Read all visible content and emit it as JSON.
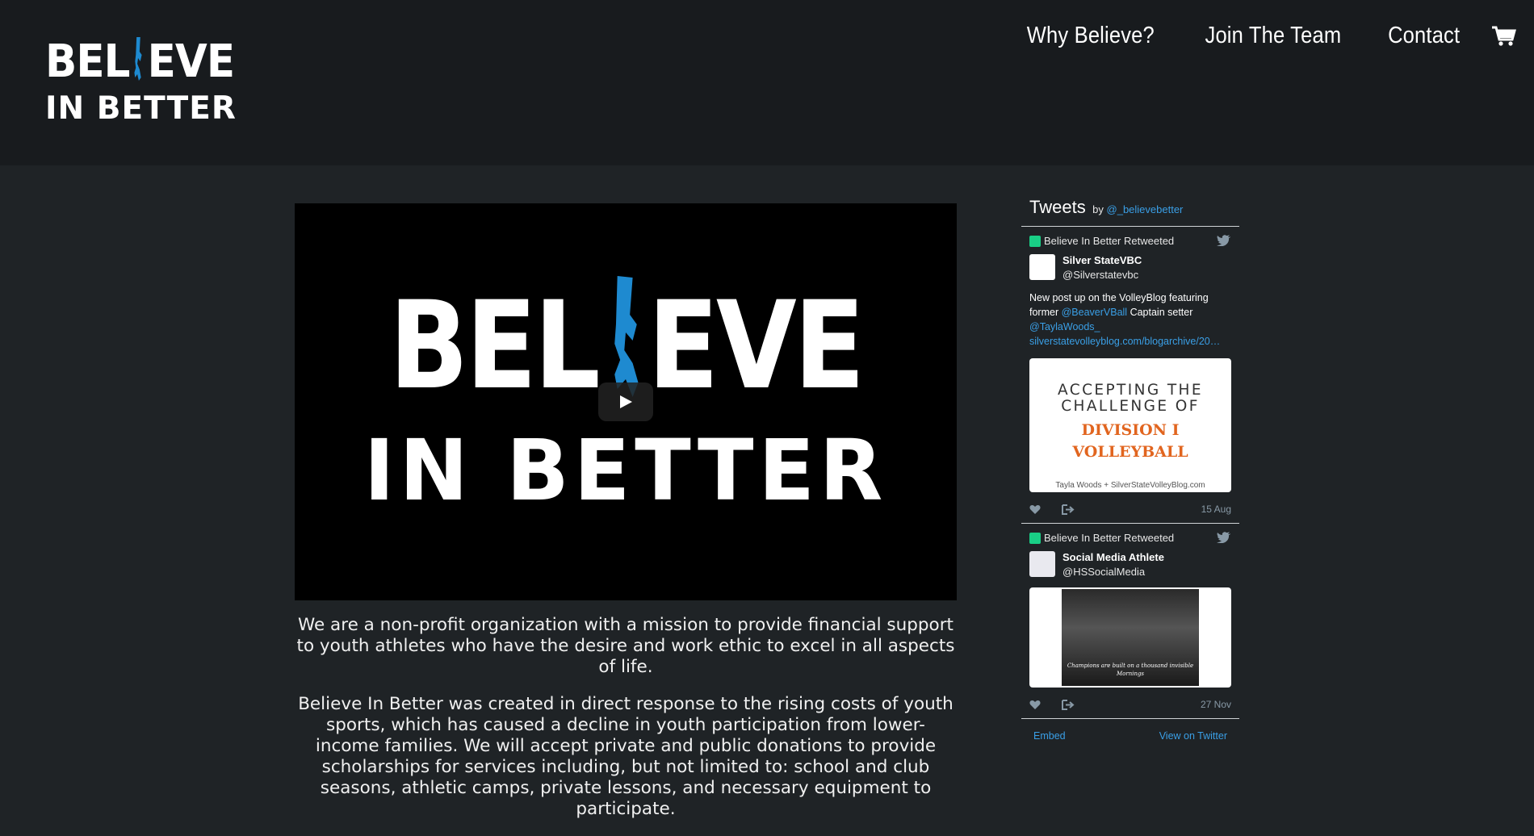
{
  "header": {
    "logo_line1_left": "BEL",
    "logo_line1_right": "EVE",
    "logo_line2": "IN BETTER",
    "nav": [
      "Why Believe?",
      "Join The Team",
      "Contact"
    ],
    "cart_icon": "shopping-cart-icon"
  },
  "video": {
    "line1_left": "BEL",
    "line1_right": "EVE",
    "line2": "IN BETTER",
    "play_icon": "play-icon"
  },
  "mission": {
    "p1": "We are a non-profit organization with a mission to provide financial support to youth athletes who have the desire and work ethic to excel in all aspects of life.",
    "p2": "Believe In Better was created in direct response to the rising costs of youth sports, which has caused a decline in youth participation from lower-income families. We will accept private and public donations to provide scholarships for services including, but not limited to: school and club seasons, athletic camps, private lessons, and necessary equipment to participate."
  },
  "twitter": {
    "title": "Tweets",
    "by": "by",
    "by_handle": "@_believebetter",
    "tweets": [
      {
        "retweeted": "Believe In Better Retweeted",
        "name": "Silver StateVBC",
        "handle": "@Silverstatevbc",
        "text_1": "New post up on the VolleyBlog featuring former",
        "mention_1": "@BeaverVBall",
        "text_2": "Captain setter",
        "mention_2": "@TaylaWoods_",
        "link": "silverstatevolleyblog.com/blogarchive/20…",
        "media_line1": "ACCEPTING THE CHALLENGE OF",
        "media_line2": "DIVISION I VOLLEYBALL",
        "media_credit": "Tayla Woods + SilverStateVolleyBlog.com",
        "date": "15 Aug"
      },
      {
        "retweeted": "Believe In Better Retweeted",
        "name": "Social Media Athlete",
        "handle": "@HSSocialMedia",
        "media_caption": "Champions are built on a thousand invisible Mornings",
        "date": "27 Nov"
      }
    ],
    "embed": "Embed",
    "view_on_twitter": "View on Twitter"
  },
  "colors": {
    "header_bg": "#181b1e",
    "page_bg": "#1f2326",
    "accent_blue": "#2b8fd0",
    "link_blue": "#3a9fe6"
  }
}
